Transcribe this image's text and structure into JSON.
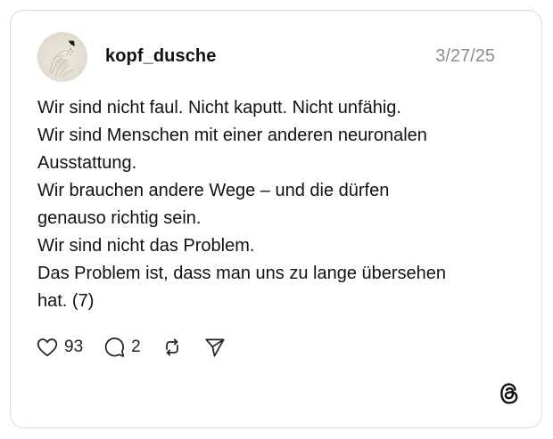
{
  "post": {
    "username": "kopf_dusche",
    "date": "3/27/25",
    "lines": [
      "Wir sind nicht faul. Nicht kaputt. Nicht unfähig.",
      "Wir sind Menschen mit einer anderen neuronalen",
      "Ausstattung.",
      "Wir brauchen andere Wege – und die dürfen",
      "genauso richtig sein.",
      "Wir sind nicht das Problem.",
      "Das Problem ist, dass man uns zu lange übersehen",
      "hat. (7)"
    ]
  },
  "actions": {
    "like": {
      "icon": "heart-icon",
      "count": "93"
    },
    "reply": {
      "icon": "comment-icon",
      "count": "2"
    },
    "repost": {
      "icon": "repost-icon"
    },
    "share": {
      "icon": "send-icon"
    }
  },
  "brand": {
    "icon": "threads-logo-icon"
  },
  "colors": {
    "border": "#dadada",
    "text": "#111111",
    "muted": "#8c8c8c"
  }
}
